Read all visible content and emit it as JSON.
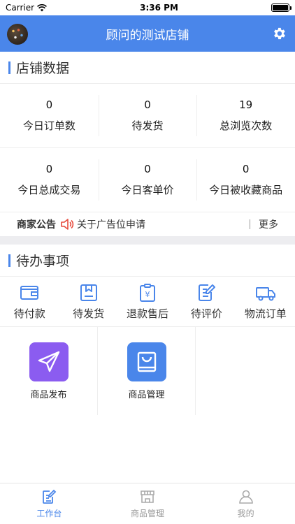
{
  "status_bar": {
    "carrier": "Carrier",
    "time": "3:36 PM"
  },
  "header": {
    "title": "顾问的测试店铺"
  },
  "store_data": {
    "section_title": "店铺数据",
    "row1": [
      {
        "value": "0",
        "label": "今日订单数"
      },
      {
        "value": "0",
        "label": "待发货"
      },
      {
        "value": "19",
        "label": "总浏览次数"
      }
    ],
    "row2": [
      {
        "value": "0",
        "label": "今日总成交易"
      },
      {
        "value": "0",
        "label": "今日客单价"
      },
      {
        "value": "0",
        "label": "今日被收藏商品"
      }
    ]
  },
  "notice": {
    "title": "商家公告",
    "text": "关于广告位申请",
    "more": "更多"
  },
  "todo": {
    "section_title": "待办事项",
    "items": [
      {
        "label": "待付款",
        "icon": "wallet-icon"
      },
      {
        "label": "待发货",
        "icon": "package-icon"
      },
      {
        "label": "退款售后",
        "icon": "refund-icon"
      },
      {
        "label": "待评价",
        "icon": "review-icon"
      },
      {
        "label": "物流订单",
        "icon": "truck-icon"
      }
    ]
  },
  "tools": [
    {
      "label": "商品发布",
      "icon": "paper-plane-icon",
      "color": "#8b5cf0"
    },
    {
      "label": "商品管理",
      "icon": "shopping-bag-icon",
      "color": "#4a86ea"
    }
  ],
  "tab_bar": {
    "items": [
      {
        "label": "工作台",
        "icon": "edit-doc-icon",
        "active": true
      },
      {
        "label": "商品管理",
        "icon": "store-icon",
        "active": false
      },
      {
        "label": "我的",
        "icon": "user-icon",
        "active": false
      }
    ]
  },
  "colors": {
    "primary": "#4a86ea",
    "publish": "#8b5cf0",
    "notice_icon": "#e64a3c"
  }
}
